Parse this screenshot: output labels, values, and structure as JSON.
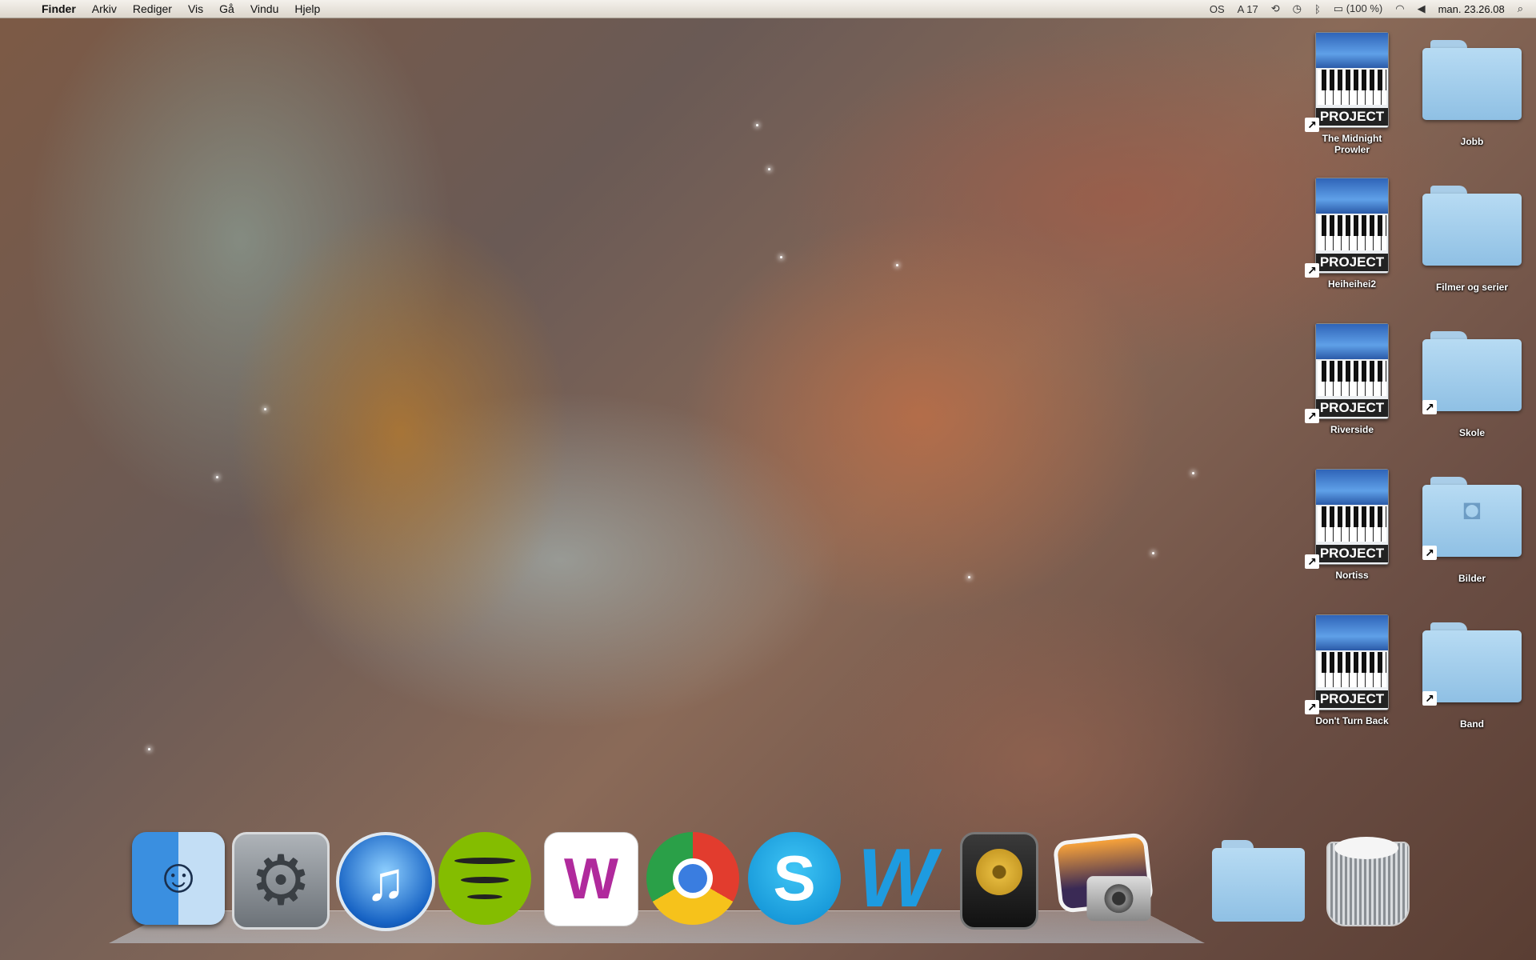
{
  "menubar": {
    "apple_icon": "",
    "items": [
      "Finder",
      "Arkiv",
      "Rediger",
      "Vis",
      "Gå",
      "Vindu",
      "Hjelp"
    ],
    "status": {
      "input_source": "OS",
      "notification_count": "17",
      "battery": "(100 %)",
      "clock": "man. 23.26.08"
    }
  },
  "desktop": {
    "projects": [
      {
        "name": "The Midnight\nProwler",
        "badge": "PROJECT"
      },
      {
        "name": "Heiheihei2",
        "badge": "PROJECT"
      },
      {
        "name": "Riverside",
        "badge": "PROJECT"
      },
      {
        "name": "Nortiss",
        "badge": "PROJECT"
      },
      {
        "name": "Don't Turn Back",
        "badge": "PROJECT"
      }
    ],
    "folders": [
      {
        "name": "Jobb"
      },
      {
        "name": "Filmer og serier"
      },
      {
        "name": "Skole"
      },
      {
        "name": "Bilder"
      },
      {
        "name": "Band"
      }
    ]
  },
  "dock": {
    "items": [
      "Finder",
      "System Preferences",
      "iTunes",
      "Spotify",
      "Winamp",
      "Google Chrome",
      "Skype",
      "Word",
      "Logic",
      "iPhoto",
      "Documents",
      "Trash"
    ]
  }
}
